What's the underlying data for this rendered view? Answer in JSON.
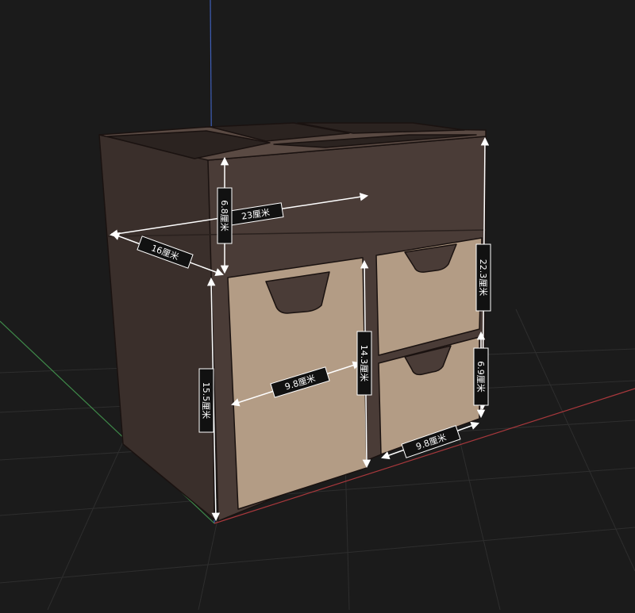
{
  "viewport": {
    "background": "#1b1b1b",
    "grid_color": "#2e2e2e",
    "axis_colors": {
      "x": "#a8383c",
      "y": "#3f8a4a",
      "z": "#3f5fb8"
    }
  },
  "model": {
    "name": "desk-organizer-with-drawers",
    "body_color": "#4a3c37",
    "body_side_color": "#3a2f2b",
    "drawer_color": "#b39c85",
    "drawer_edge_color": "#6a5a4c",
    "outline_color": "#1a1210"
  },
  "dimensions": {
    "overall_width": "23厘米",
    "depth": "16厘米",
    "top_compartment_height": "6.8厘米",
    "total_height_side": "15.5厘米",
    "total_height_front": "22.3厘米",
    "large_drawer_height": "14.3厘米",
    "large_drawer_width": "9.8厘米",
    "small_drawer_height": "6.9厘米",
    "small_drawer_width": "9.8厘米"
  }
}
